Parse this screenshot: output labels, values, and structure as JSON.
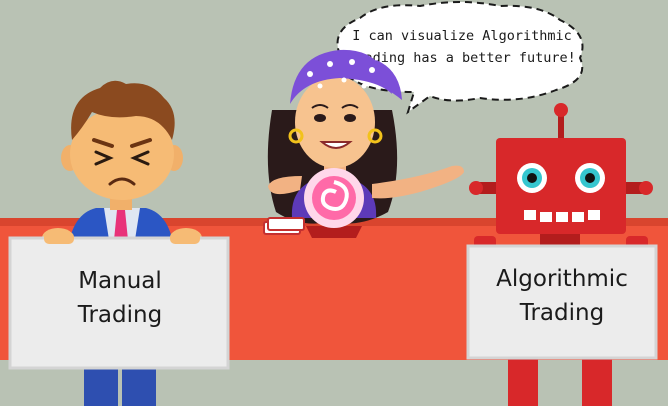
{
  "speech_bubble": {
    "line1": "I can visualize Algorithmic",
    "line2": "Trading has a better future!"
  },
  "signs": {
    "manual": {
      "line1": "Manual",
      "line2": "Trading"
    },
    "algorithmic": {
      "line1": "Algorithmic",
      "line2": "Trading"
    }
  },
  "colors": {
    "background": "#b9c2b4",
    "table_band": "#f0553b",
    "robot": "#d8282a",
    "fortune_teller_scarf": "#7c4fd8",
    "crystal_ball_glow": "#ff6aa8",
    "businessman_shirt": "#dfe6f2",
    "businessman_tie": "#e8327a",
    "sign_board": "#ececec"
  }
}
